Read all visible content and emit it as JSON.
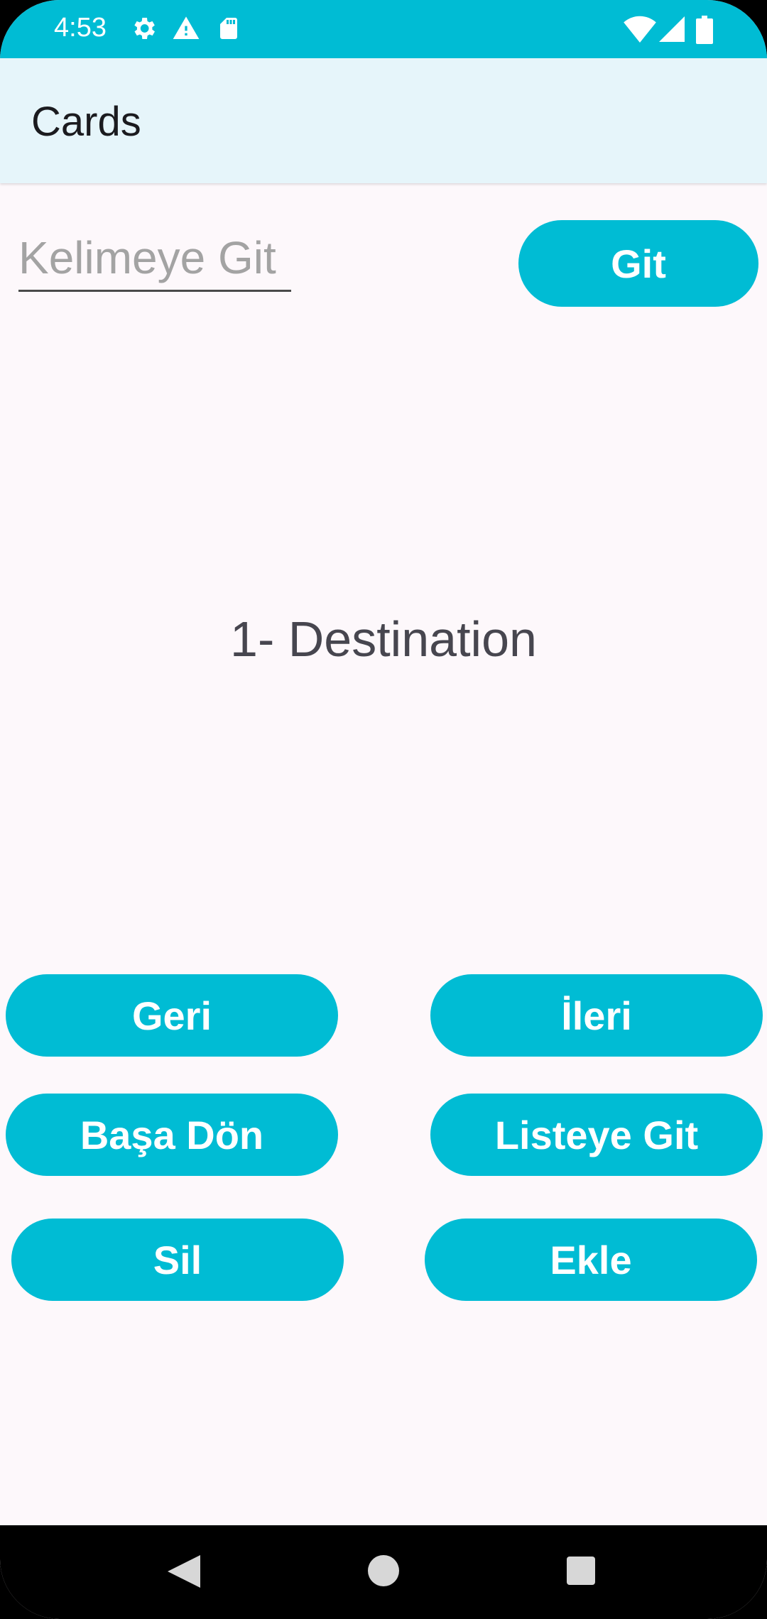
{
  "status_bar": {
    "time": "4:53",
    "left_icons": [
      "gear-icon",
      "warning-icon",
      "sd-card-icon"
    ],
    "right_icons": [
      "wifi-icon",
      "signal-icon",
      "battery-icon"
    ],
    "color": "#00bcd4"
  },
  "app_bar": {
    "title": "Cards"
  },
  "search": {
    "placeholder": "Kelimeye Git",
    "value": "",
    "button_label": "Git"
  },
  "card": {
    "text": "1- Destination"
  },
  "buttons": {
    "back": "Geri",
    "next": "İleri",
    "to_start": "Başa Dön",
    "to_list": "Listeye Git",
    "delete": "Sil",
    "add": "Ekle"
  },
  "nav_bar": {
    "icons": [
      "back-icon",
      "home-icon",
      "recents-icon"
    ]
  },
  "colors": {
    "accent": "#00bcd4",
    "background": "#fdf8fb",
    "app_bar": "#e6f5fa"
  }
}
